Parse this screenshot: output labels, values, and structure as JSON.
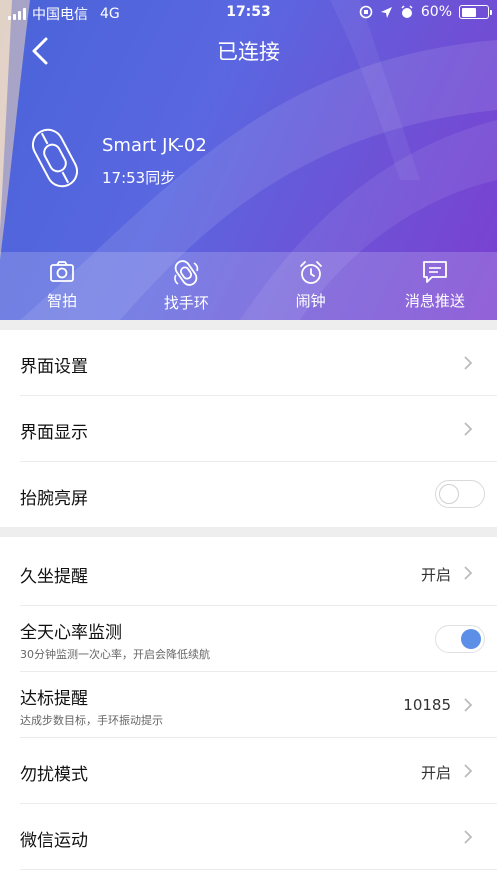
{
  "status_bar": {
    "carrier": "中国电信",
    "network": "4G",
    "time": "17:53",
    "battery": "60%",
    "battery_level": 0.6
  },
  "nav": {
    "title": "已连接",
    "back_icon": "chevron-left-icon"
  },
  "device": {
    "name": "Smart JK-02",
    "sync": "17:53同步",
    "icon": "smart-band-icon"
  },
  "tools": [
    {
      "label": "智拍",
      "icon": "camera-icon"
    },
    {
      "label": "找手环",
      "icon": "find-band-icon"
    },
    {
      "label": "闹钟",
      "icon": "alarm-clock-icon"
    },
    {
      "label": "消息推送",
      "icon": "message-icon"
    }
  ],
  "settings_group1": [
    {
      "title": "界面设置",
      "control": "chevron"
    },
    {
      "title": "界面显示",
      "control": "chevron"
    },
    {
      "title": "抬腕亮屏",
      "control": "toggle",
      "on": false
    }
  ],
  "settings_group2": [
    {
      "title": "久坐提醒",
      "value": "开启",
      "control": "chevron"
    },
    {
      "title": "全天心率监测",
      "subtitle": "30分钟监测一次心率，开启会降低续航",
      "control": "toggle",
      "on": true
    },
    {
      "title": "达标提醒",
      "subtitle": "达成步数目标，手环振动提示",
      "value": "10185",
      "control": "chevron"
    },
    {
      "title": "勿扰模式",
      "value": "开启",
      "control": "chevron"
    },
    {
      "title": "微信运动",
      "control": "chevron"
    }
  ],
  "colors": {
    "header_start": "#4a63d8",
    "header_end": "#7b3fd0",
    "toggle_on": "#5b8fe8",
    "section_gap": "#eeeeee"
  }
}
